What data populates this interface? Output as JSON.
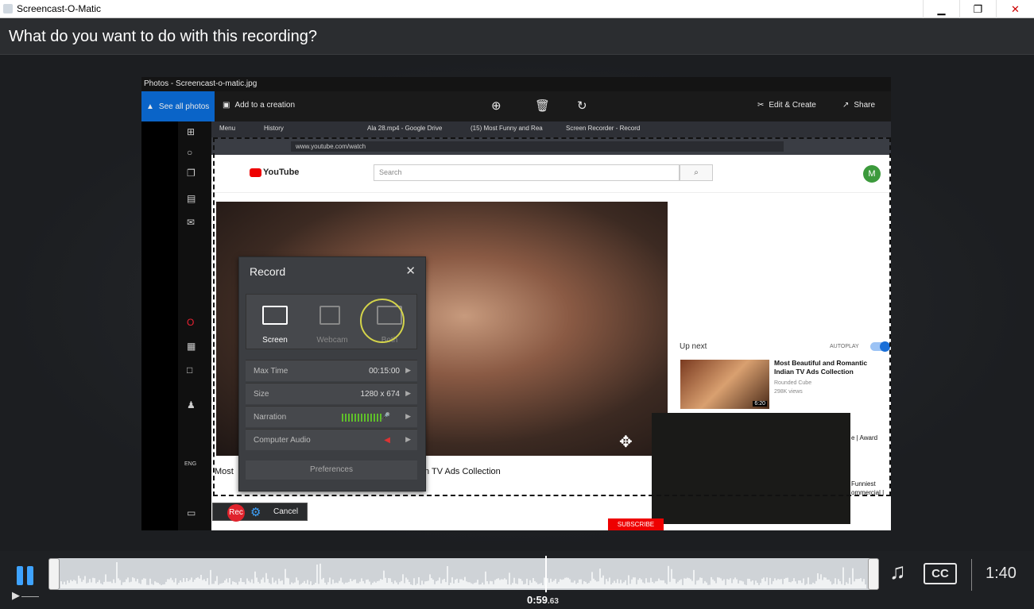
{
  "window": {
    "title": "Screencast-O-Matic",
    "minimize": "▁",
    "maximize": "❐",
    "close": "✕"
  },
  "header": {
    "question": "What do you want to do with this recording?"
  },
  "preview": {
    "photos_title": "Photos - Screencast-o-matic.jpg",
    "see_all": "See all photos",
    "add_creation": "Add to a creation",
    "edit_create": "Edit & Create",
    "share": "Share",
    "tabs": [
      "Menu",
      "History",
      "Ala 28.mp4 - Google Drive",
      "(15) Most Funny and Rea",
      "Screen Recorder - Record"
    ],
    "url": "www.youtube.com/watch",
    "yt_logo": "YouTube",
    "search_placeholder": "Search",
    "avatar_letter": "M",
    "upnext": "Up next",
    "autoplay": "AUTOPLAY",
    "vid_title": "Most Beautiful and Romantic Indian TV Ads Collection",
    "vid_channel": "Rounded Cube",
    "vid_views": "298K views",
    "vid_duration": "6:20",
    "under_left": "Most",
    "under_right": "n TV Ads Collection",
    "side_frag1": "e | Award",
    "side_frag2": "Funniest",
    "side_frag3": "ommercial |",
    "subscribe": "SUBSCRIBE",
    "record_dialog": {
      "title": "Record",
      "modes": [
        "Screen",
        "Webcam",
        "Both"
      ],
      "options": [
        {
          "key": "Max Time",
          "value": "00:15:00"
        },
        {
          "key": "Size",
          "value": "1280 x 674"
        },
        {
          "key": "Narration",
          "value": ""
        },
        {
          "key": "Computer Audio",
          "value": ""
        }
      ],
      "preferences": "Preferences"
    },
    "recbar": {
      "rec": "Rec",
      "cancel": "Cancel"
    }
  },
  "player": {
    "current_time": "0:59",
    "current_frac": ".63",
    "duration": "1:40",
    "cc": "CC",
    "progress_fraction": 0.59
  },
  "colors": {
    "accent": "#3ea3ff",
    "record": "#e0232c"
  }
}
